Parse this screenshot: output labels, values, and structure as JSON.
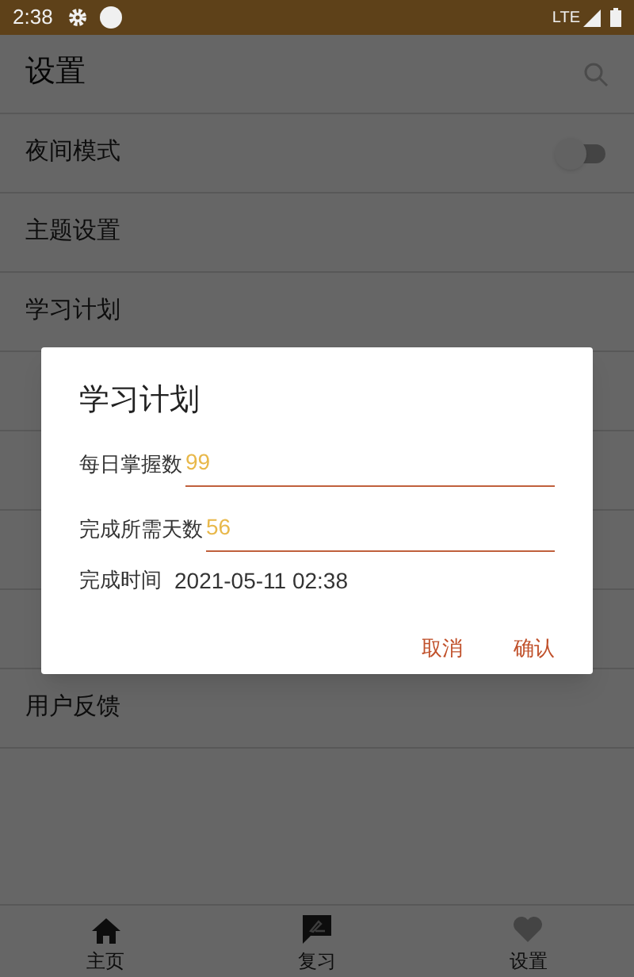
{
  "status_bar": {
    "time": "2:38",
    "network": "LTE"
  },
  "app_bar": {
    "title": "设置"
  },
  "settings": [
    {
      "kind": "switch",
      "label": "夜间模式",
      "on": false
    },
    {
      "kind": "plain",
      "label": "主题设置"
    },
    {
      "kind": "plain",
      "label": "学习计划"
    },
    {
      "kind": "covered"
    },
    {
      "kind": "covered"
    },
    {
      "kind": "covered"
    },
    {
      "kind": "covered"
    },
    {
      "kind": "plain",
      "label": "用户反馈"
    }
  ],
  "dialog": {
    "title": "学习计划",
    "fields": [
      {
        "label": "每日掌握数",
        "value": "99"
      },
      {
        "label": "完成所需天数",
        "value": "56"
      }
    ],
    "finish_label": "完成时间",
    "finish_time": "2021-05-11 02:38",
    "buttons": [
      "取消",
      "确认"
    ]
  },
  "bottom_nav": [
    {
      "kind": "home",
      "label": "主页",
      "selected": false
    },
    {
      "kind": "review",
      "label": "复习",
      "selected": false
    },
    {
      "kind": "settings",
      "label": "设置",
      "selected": true
    }
  ]
}
